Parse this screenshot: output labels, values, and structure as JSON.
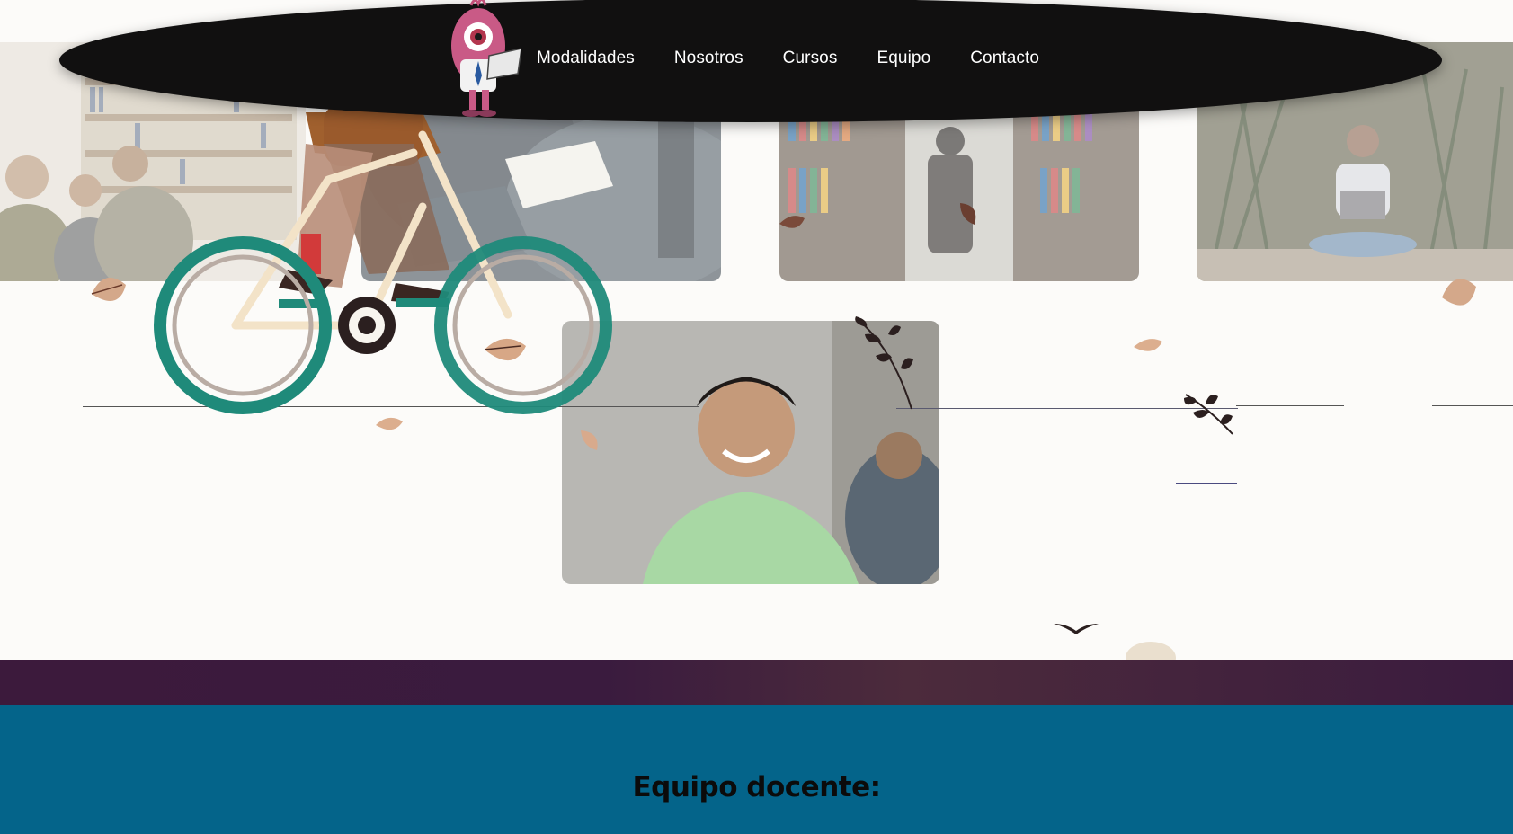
{
  "nav": {
    "items": [
      {
        "label": "Modalidades"
      },
      {
        "label": "Nosotros"
      },
      {
        "label": "Cursos"
      },
      {
        "label": "Equipo"
      },
      {
        "label": "Contacto"
      }
    ]
  },
  "team_section": {
    "heading": "Equipo docente:"
  },
  "colors": {
    "nav_background": "#111010",
    "nav_text": "#ffffff",
    "page_background": "#fcfbf9",
    "purple_band": "#3c1a3c",
    "team_section_background": "#04648a",
    "bike_wheel": "#1f8a7a"
  },
  "icons": {
    "logo": "pink-monster-mascot-with-laptop",
    "illustration": "person-riding-bicycle",
    "decor": [
      "leaf",
      "branch",
      "bird"
    ]
  }
}
